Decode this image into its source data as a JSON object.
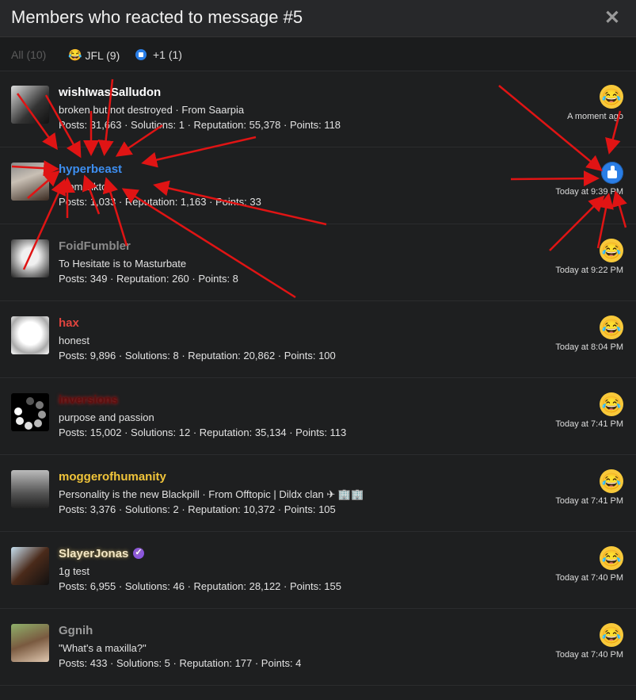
{
  "header": {
    "title": "Members who reacted to message #5",
    "close_icon": "close-icon",
    "close_glyph": "✕"
  },
  "tabs": [
    {
      "label": "All (10)",
      "icon": ""
    },
    {
      "label": "JFL (9)",
      "icon": "joy-emoji-icon"
    },
    {
      "label": "+1 (1)",
      "icon": "thumbs-up-icon"
    }
  ],
  "members": [
    {
      "name": "wishIwasSalludon",
      "name_color": "#ffffff",
      "line1": "broken but not destroyed · From Saarpia",
      "line2": "Posts: 31,663 · Solutions: 1 · Reputation: 55,378 · Points: 118",
      "reaction": "JFL",
      "time": "A moment ago"
    },
    {
      "name": "hyperbeast",
      "name_color": "#3d8ef0",
      "line1": "From Tiktok",
      "line2": "Posts: 1,033 · Reputation: 1,163 · Points: 33",
      "reaction": "+1",
      "time": "Today at 9:39 PM"
    },
    {
      "name": "FoidFumbler",
      "name_color": "#8a8a8a",
      "line1": "To Hesitate is to Masturbate",
      "line2": "Posts: 349 · Reputation: 260 · Points: 8",
      "reaction": "JFL",
      "time": "Today at 9:22 PM"
    },
    {
      "name": "hax",
      "name_color": "#e0443e",
      "line1": "honest",
      "line2": "Posts: 9,896 · Solutions: 8 · Reputation: 20,862 · Points: 100",
      "reaction": "JFL",
      "time": "Today at 8:04 PM"
    },
    {
      "name": "inversions",
      "name_color": "#5a0f0f",
      "line1": "purpose and passion",
      "line2": "Posts: 15,002 · Solutions: 12 · Reputation: 35,134 · Points: 113",
      "reaction": "JFL",
      "time": "Today at 7:41 PM"
    },
    {
      "name": "moggerofhumanity",
      "name_color": "#f0c43a",
      "line1": "Personality is the new Blackpill · From Offtopic | Dildx clan ✈ 🏢🏢",
      "line2": "Posts: 3,376 · Solutions: 2 · Reputation: 10,372 · Points: 105",
      "reaction": "JFL",
      "time": "Today at 7:41 PM"
    },
    {
      "name": "SlayerJonas",
      "name_color": "#f3e7c6",
      "line1": "1g test",
      "line2": "Posts: 6,955 · Solutions: 46 · Reputation: 28,122 · Points: 155",
      "reaction": "JFL",
      "time": "Today at 7:40 PM",
      "verified": true
    },
    {
      "name": "Ggnih",
      "name_color": "#9a9a9a",
      "line1": "\"What's a maxilla?\"",
      "line2": "Posts: 433 · Solutions: 5 · Reputation: 177 · Points: 4",
      "reaction": "JFL",
      "time": "Today at 7:40 PM"
    }
  ],
  "colors": {
    "background": "#1e1f20",
    "header": "#27282a",
    "arrow": "#e01414",
    "like": "#2a7ee6",
    "emoji": "#f8c93a"
  }
}
